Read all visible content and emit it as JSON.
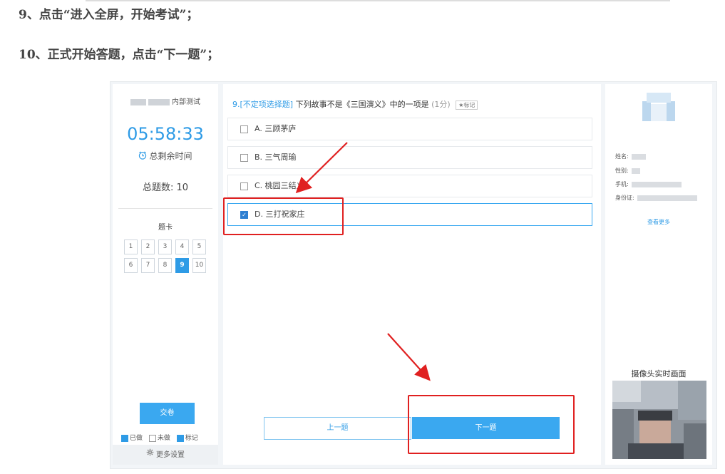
{
  "instructions": {
    "step9": "9、点击“进入全屏，开始考试”；",
    "step10": "10、正式开始答题，点击“下一题”；"
  },
  "left_panel": {
    "exam_name_suffix": "内部测试",
    "timer": "05:58:33",
    "remaining_label": "总剩余时间",
    "total_label": "总题数: 10",
    "answer_card_title": "题卡",
    "question_numbers": [
      "1",
      "2",
      "3",
      "4",
      "5",
      "6",
      "7",
      "8",
      "9",
      "10"
    ],
    "current_question": "9",
    "submit_label": "交卷",
    "legend": {
      "done": "已做",
      "undone": "未做",
      "marked": "标记"
    },
    "more_settings": "更多设置"
  },
  "question": {
    "number": "9.",
    "type": "[不定项选择题]",
    "text": "下列故事不是《三国演义》中的一项是",
    "score": "(1分)",
    "mark_label": "标记",
    "options": [
      {
        "label": "A. 三顾茅庐",
        "checked": false
      },
      {
        "label": "B. 三气周瑜",
        "checked": false
      },
      {
        "label": "C. 桃园三结义",
        "checked": false
      },
      {
        "label": "D. 三打祝家庄",
        "checked": true
      }
    ],
    "prev_label": "上一题",
    "next_label": "下一题"
  },
  "right_panel": {
    "name_label": "姓名:",
    "gender_label": "性别:",
    "phone_label": "手机:",
    "id_label": "身份证:",
    "view_more": "查看更多",
    "camera_label": "摄像头实时画面"
  },
  "colors": {
    "accent": "#2e9be6",
    "button": "#3aa8f0",
    "annotation": "#e02020"
  }
}
